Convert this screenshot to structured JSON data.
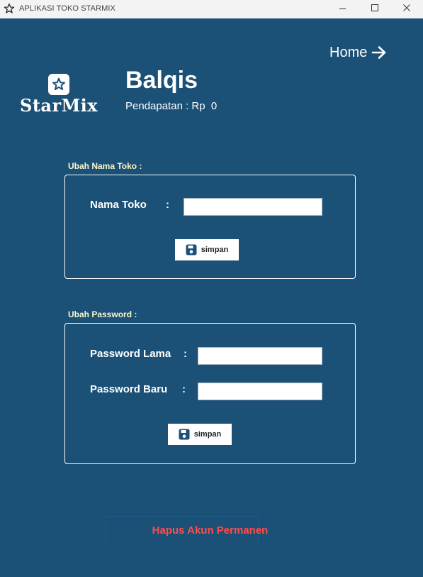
{
  "window": {
    "title": "APLIKASI TOKO STARMIX",
    "controls": [
      "minimize",
      "maximize",
      "close"
    ]
  },
  "header": {
    "home_label": "Home",
    "logo_text": "StarMix",
    "user_name": "Balqis",
    "income_label": "Pendapatan : Rp  0"
  },
  "store_form": {
    "section_title": "Ubah Nama Toko :",
    "field_label": "Nama Toko",
    "colon": ":",
    "value": "",
    "save_label": "simpan"
  },
  "password_form": {
    "section_title": "Ubah Password :",
    "old_label": "Password Lama",
    "new_label": "Password Baru",
    "colon": ":",
    "old_value": "",
    "new_value": "",
    "save_label": "simpan"
  },
  "danger": {
    "delete_label": "Hapus Akun Permanen"
  },
  "colors": {
    "background": "#1b5077",
    "danger_text": "#ff4d4d",
    "section_label": "#fff6c8"
  }
}
